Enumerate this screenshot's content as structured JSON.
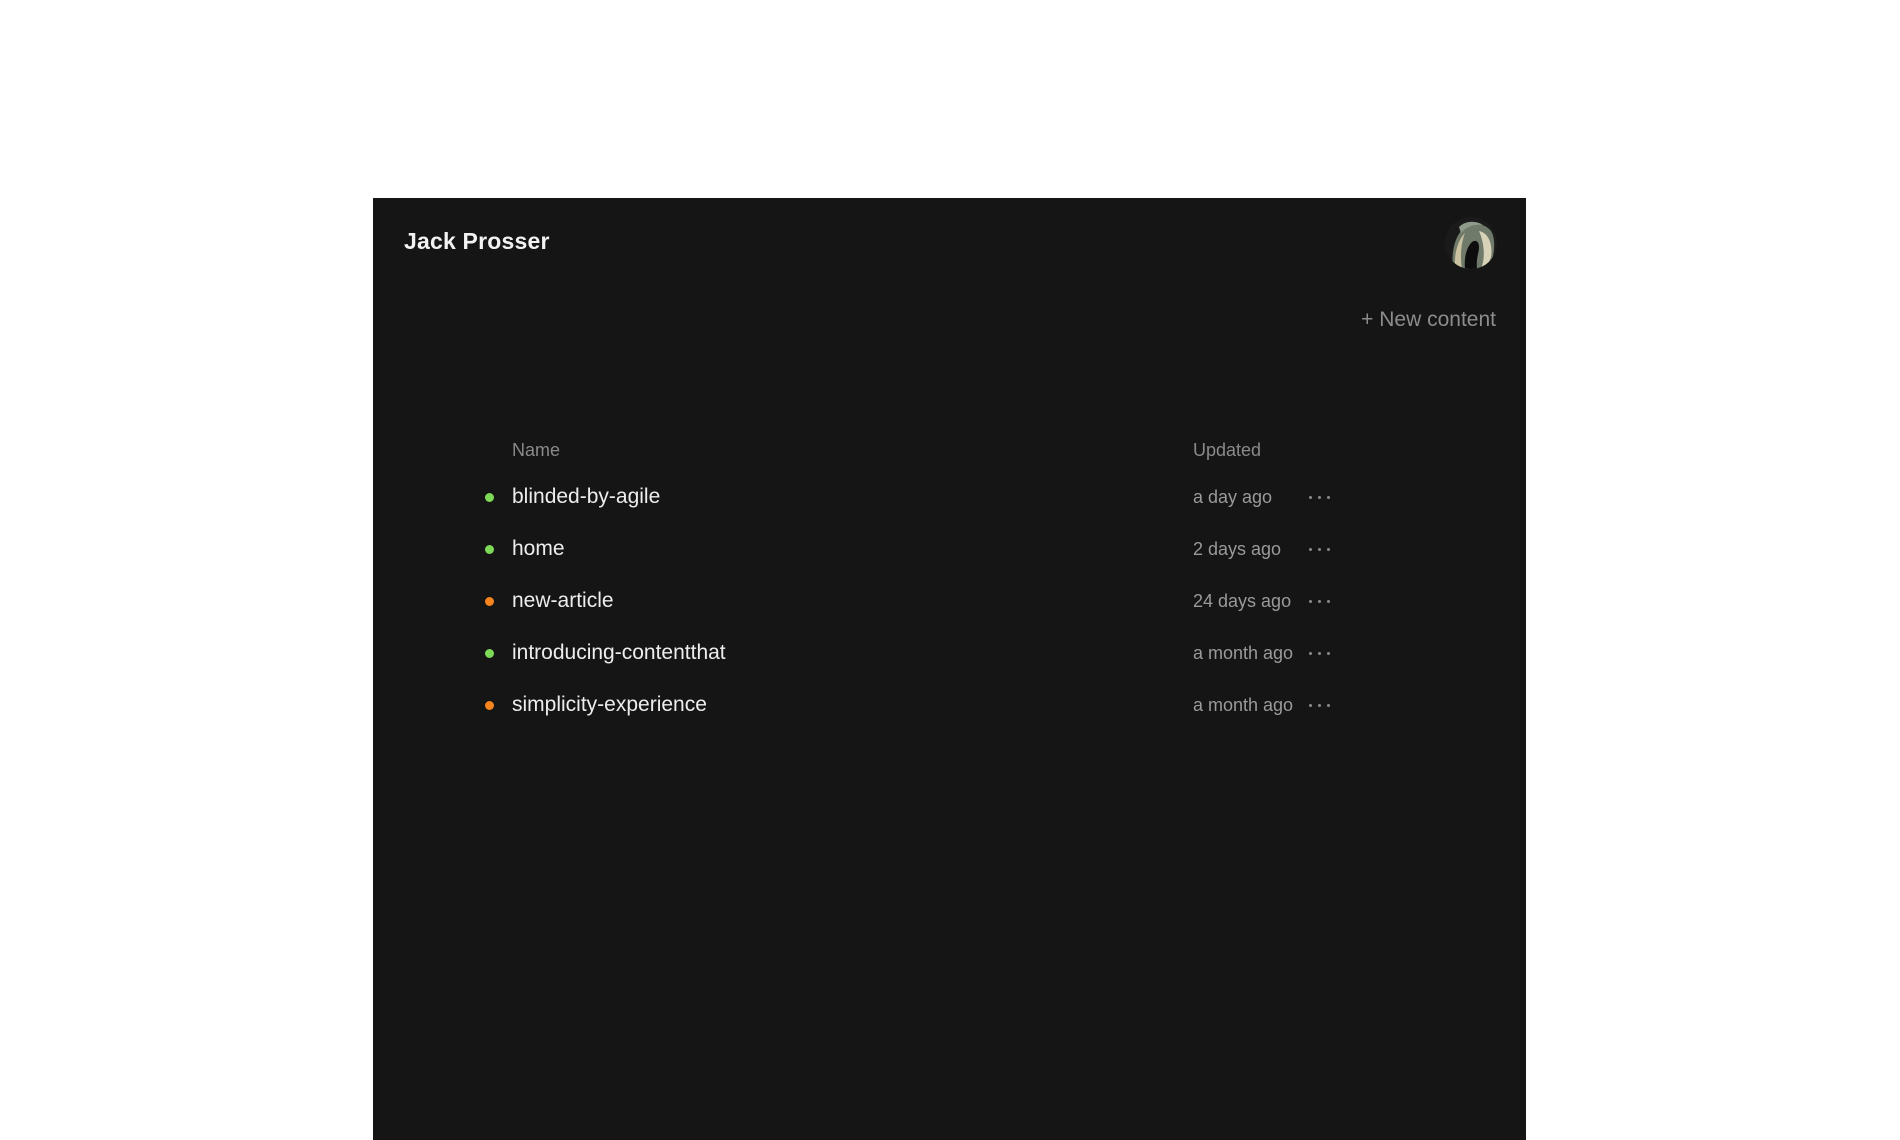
{
  "header": {
    "user_name": "Jack Prosser",
    "avatar_icon": "user-avatar-photo"
  },
  "actions": {
    "new_content_label": "+ New content"
  },
  "table": {
    "columns": {
      "name": "Name",
      "updated": "Updated"
    },
    "rows": [
      {
        "name": "blinded-by-agile",
        "updated": "a day ago",
        "status_color": "#7ed957",
        "more_icon": "ellipsis-icon"
      },
      {
        "name": "home",
        "updated": "2 days ago",
        "status_color": "#7ed957",
        "more_icon": "ellipsis-icon"
      },
      {
        "name": "new-article",
        "updated": "24 days ago",
        "status_color": "#f5841f",
        "more_icon": "ellipsis-icon"
      },
      {
        "name": "introducing-contentthat",
        "updated": "a month ago",
        "status_color": "#7ed957",
        "more_icon": "ellipsis-icon"
      },
      {
        "name": "simplicity-experience",
        "updated": "a month ago",
        "status_color": "#f5841f",
        "more_icon": "ellipsis-icon"
      }
    ]
  },
  "colors": {
    "panel_background": "#151515",
    "published": "#7ed957",
    "draft": "#f5841f"
  }
}
